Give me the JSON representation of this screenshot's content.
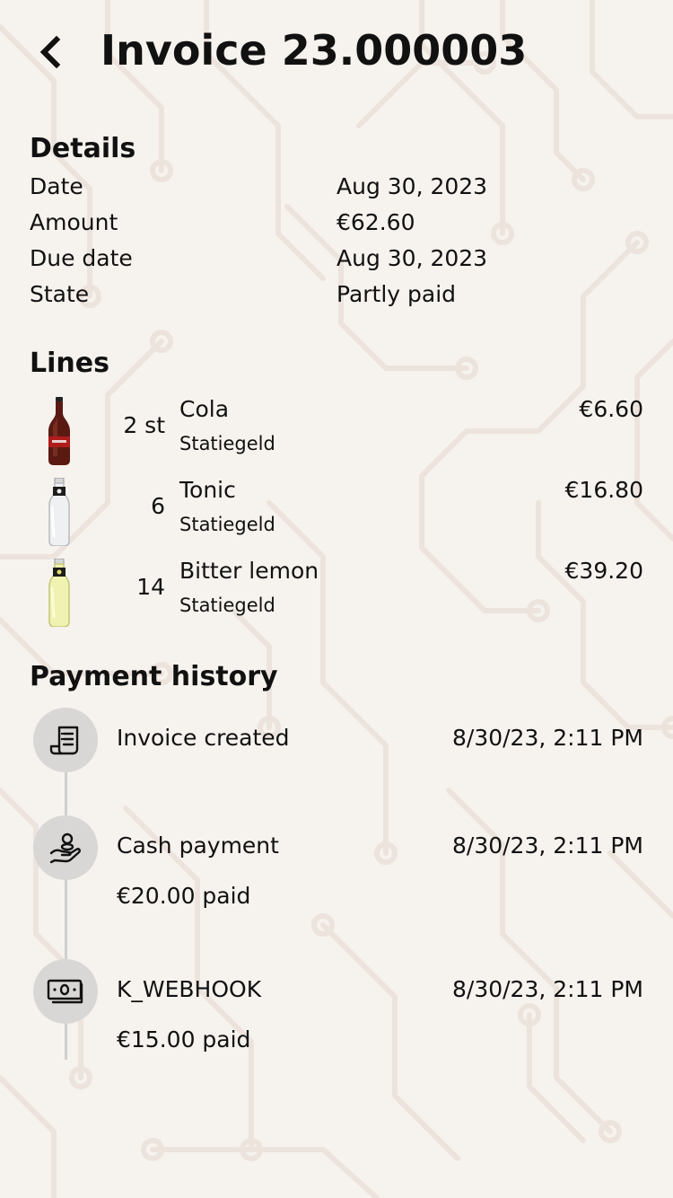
{
  "header": {
    "title": "Invoice 23.000003",
    "back_icon": "chevron-left-icon"
  },
  "details": {
    "title": "Details",
    "rows": [
      {
        "label": "Date",
        "value": "Aug 30, 2023"
      },
      {
        "label": "Amount",
        "value": "€62.60"
      },
      {
        "label": "Due date",
        "value": "Aug 30, 2023"
      },
      {
        "label": "State",
        "value": "Partly paid"
      }
    ]
  },
  "lines": {
    "title": "Lines",
    "items": [
      {
        "qty": "2 st",
        "name": "Cola",
        "sub": "Statiegeld",
        "price": "€6.60",
        "icon": "cola-bottle-icon"
      },
      {
        "qty": "6",
        "name": "Tonic",
        "sub": "Statiegeld",
        "price": "€16.80",
        "icon": "tonic-bottle-icon"
      },
      {
        "qty": "14",
        "name": "Bitter lemon",
        "sub": "Statiegeld",
        "price": "€39.20",
        "icon": "bitter-lemon-bottle-icon"
      }
    ]
  },
  "history": {
    "title": "Payment history",
    "events": [
      {
        "title": "Invoice created",
        "time": "8/30/23, 2:11 PM",
        "sub": "",
        "icon": "receipt-icon"
      },
      {
        "title": "Cash payment",
        "time": "8/30/23, 2:11 PM",
        "sub": "€20.00 paid",
        "icon": "cash-hand-icon"
      },
      {
        "title": "K_WEBHOOK",
        "time": "8/30/23, 2:11 PM",
        "sub": "€15.00 paid",
        "icon": "banknote-icon"
      }
    ]
  },
  "colors": {
    "background": "#f6f2ed",
    "circuit_pattern": "#ede2dc",
    "icon_circle": "#d9d7d6",
    "timeline": "#cfcfcf",
    "text": "#111111"
  }
}
